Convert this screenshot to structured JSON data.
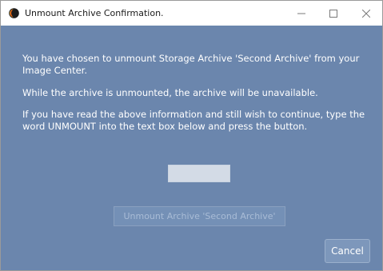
{
  "window": {
    "title": "Unmount Archive Confirmation.",
    "controls": {
      "minimize_icon": "minimize-icon",
      "maximize_icon": "maximize-icon",
      "close_icon": "close-icon"
    }
  },
  "message": {
    "line1": "You have chosen to unmount Storage Archive 'Second Archive' from your",
    "line1b": "Image Center.",
    "line2": "While the archive is unmounted, the archive will be unavailable.",
    "line3": "If you have read the above information and still wish to continue, type the",
    "line3b": "word UNMOUNT into the text box below and press the button."
  },
  "confirm_input": {
    "value": "",
    "placeholder": ""
  },
  "buttons": {
    "unmount_label": "Unmount Archive 'Second Archive'",
    "unmount_enabled": false,
    "cancel_label": "Cancel"
  },
  "colors": {
    "dialog_background": "#6b86ad",
    "text": "#ffffff",
    "disabled_text": "#a9bcd6"
  }
}
